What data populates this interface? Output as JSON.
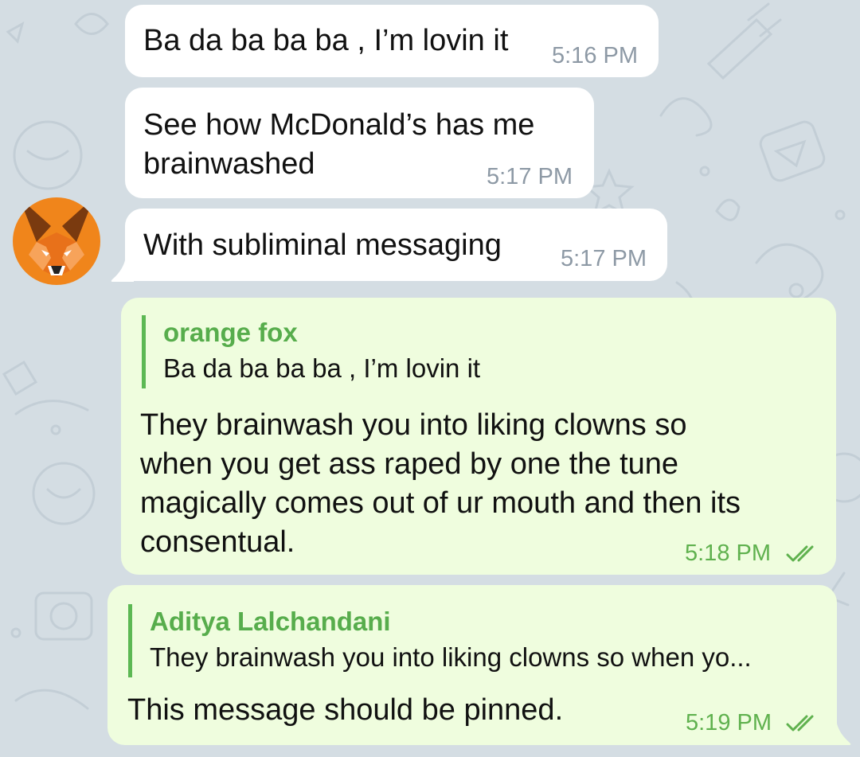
{
  "theme": {
    "background": "#d4dde3",
    "incoming_bubble": "#ffffff",
    "outgoing_bubble": "#effdde",
    "reply_accent": "#5cb853",
    "outgoing_time": "#5fb14e",
    "incoming_time": "#8d99a5"
  },
  "avatar": {
    "icon": "fox-icon",
    "color": "#f0851b"
  },
  "messages": [
    {
      "direction": "incoming",
      "text": "Ba da ba ba ba , I’m lovin it",
      "time": "5:16 PM"
    },
    {
      "direction": "incoming",
      "lines": [
        "See how McDonald’s has me",
        "brainwashed"
      ],
      "time": "5:17 PM"
    },
    {
      "direction": "incoming",
      "text": "With subliminal messaging",
      "time": "5:17 PM"
    },
    {
      "direction": "outgoing",
      "reply": {
        "name": "orange fox",
        "text": "Ba da ba ba ba , I’m lovin it"
      },
      "lines": [
        "They brainwash you into liking clowns so",
        "when you get ass raped by one the tune",
        "magically comes out of ur mouth and then its",
        "consentual."
      ],
      "time": "5:18 PM",
      "status": "read"
    },
    {
      "direction": "outgoing",
      "reply": {
        "name": "Aditya Lalchandani",
        "text": "They brainwash you into liking clowns so when yo..."
      },
      "text": "This message should be pinned.",
      "time": "5:19 PM",
      "status": "read"
    }
  ]
}
